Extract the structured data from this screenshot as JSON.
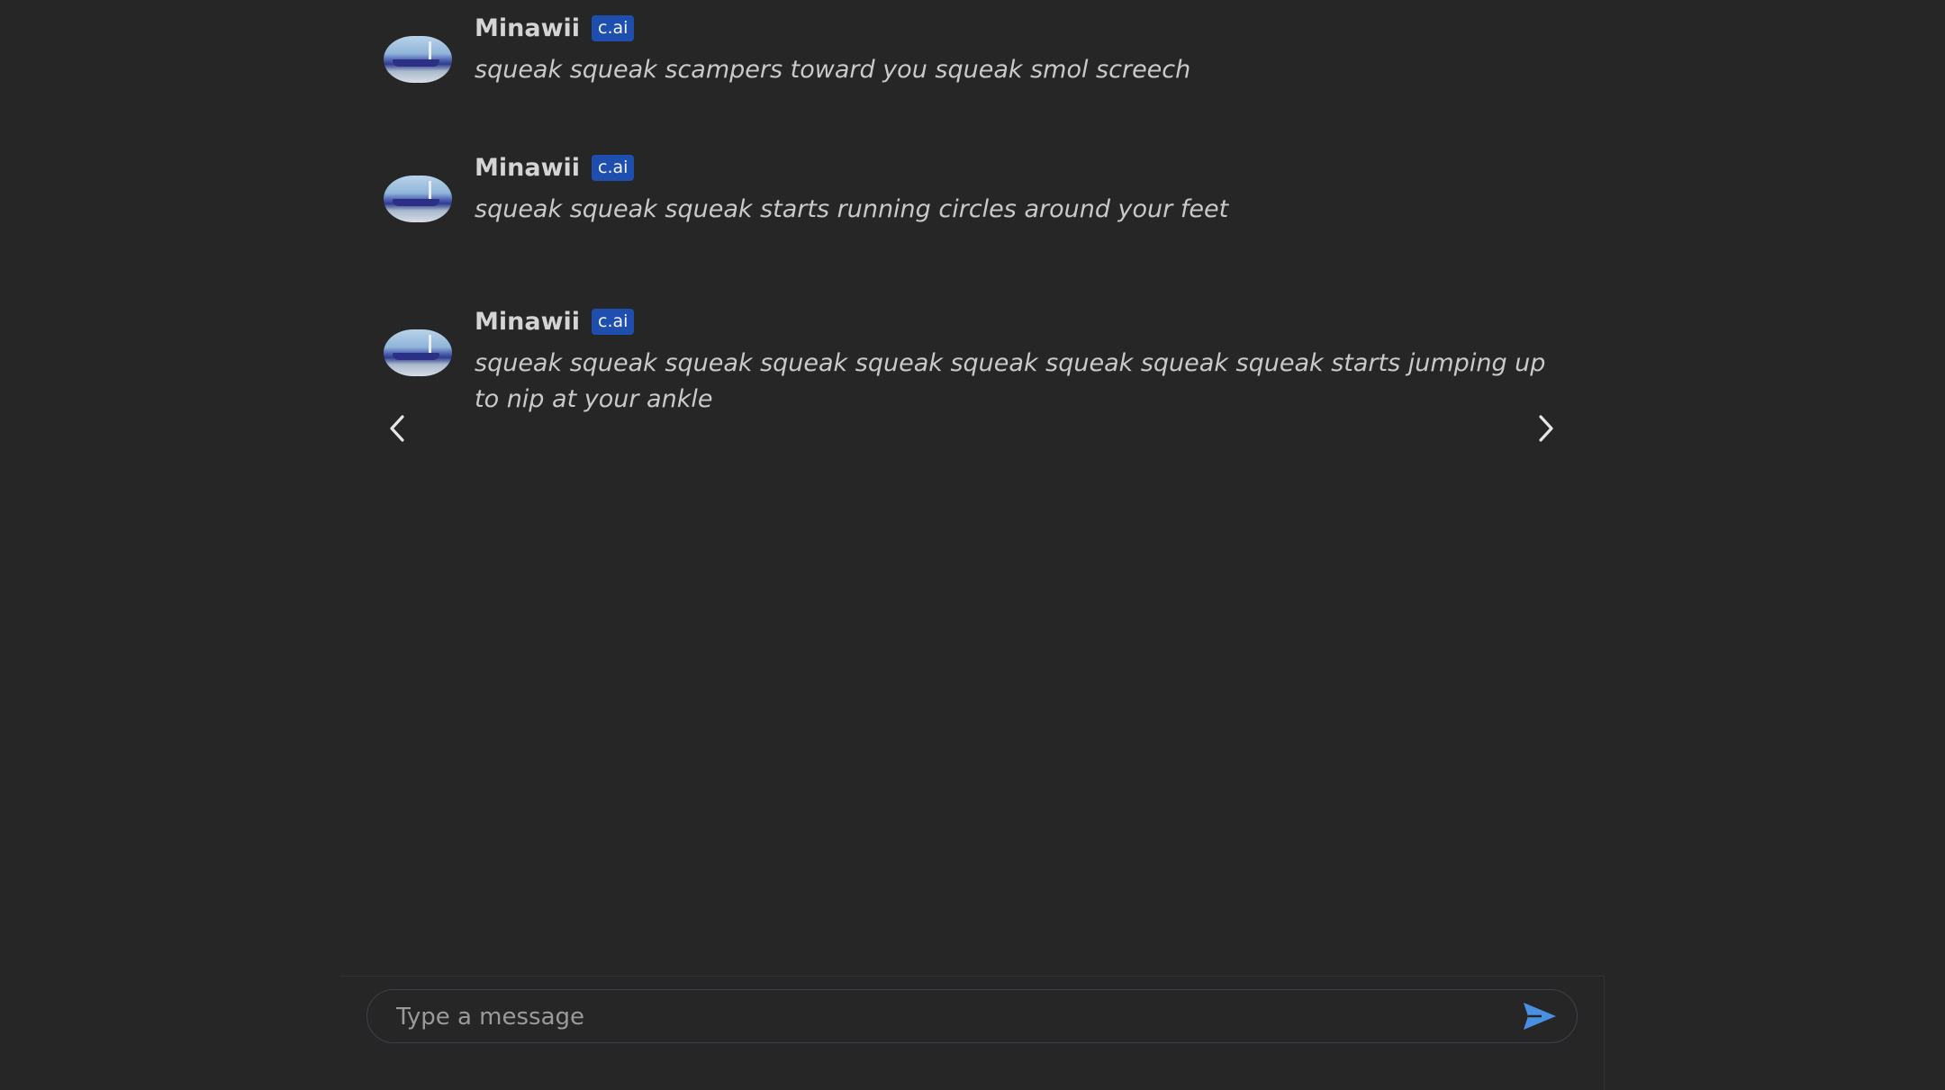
{
  "messages": [
    {
      "sender": "Minawii",
      "badge": "c.ai",
      "text": "squeak squeak scampers toward you squeak smol screech"
    },
    {
      "sender": "Minawii",
      "badge": "c.ai",
      "text": "squeak squeak squeak starts running circles around your feet"
    },
    {
      "sender": "Minawii",
      "badge": "c.ai",
      "text": "squeak squeak squeak squeak squeak squeak squeak squeak squeak starts jumping up to nip at your ankle"
    }
  ],
  "swipe": {
    "prev_icon": "chevron-left-icon",
    "next_icon": "chevron-right-icon"
  },
  "composer": {
    "placeholder": "Type a message",
    "value": "",
    "send_icon": "send-icon"
  },
  "colors": {
    "background": "#262626",
    "badge": "#1f4fae",
    "send_accent": "#4a90e2"
  }
}
